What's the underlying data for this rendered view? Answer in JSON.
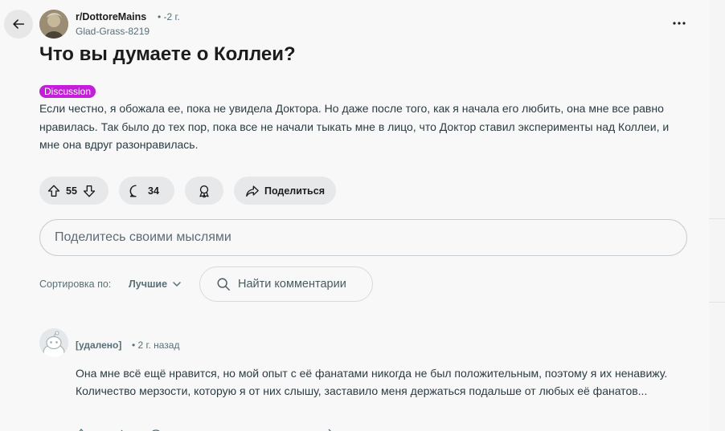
{
  "post": {
    "subreddit": "r/DottoreMains",
    "age": "• -2 г.",
    "author": "Glad-Grass-8219",
    "title": "Что вы думаете о Коллеи?",
    "flair": "Discussion",
    "flair_color": "#c31ed8",
    "body": "Если честно, я обожала ее, пока не увидела Доктора. Но даже после того, как я начала его любить, она мне все равно нравилась. Так было до тех пор, пока все не начали тыкать мне в лицо, что Доктор ставил эксперименты над Коллеи, и мне она вдруг разонравилась."
  },
  "actions": {
    "votes": "55",
    "comments": "34",
    "share_label": "Поделиться"
  },
  "comment_input": {
    "placeholder": "Поделитесь своими мыслями"
  },
  "sort": {
    "label": "Сортировка по:",
    "value": "Лучшие"
  },
  "comment_search": {
    "placeholder": "Найти комментарии"
  },
  "comments": [
    {
      "author": "[удалено]",
      "time": "• 2 г. назад",
      "text": "Она мне всё ещё нравится, но мой опыт с её фанатами никогда не был положительным, поэтому я их ненавижу. Количество мерзости, которую я от них слышу, заставило меня держаться подальше от любых её фанатов..."
    }
  ],
  "icons": {
    "back": "arrow-left-icon",
    "more": "more-horizontal-icon",
    "upvote": "upvote-arrow-icon",
    "downvote": "downvote-arrow-icon",
    "comment": "speech-bubble-icon",
    "award": "award-icon",
    "share": "share-arrow-icon",
    "search": "search-icon",
    "chevron": "chevron-down-icon"
  }
}
